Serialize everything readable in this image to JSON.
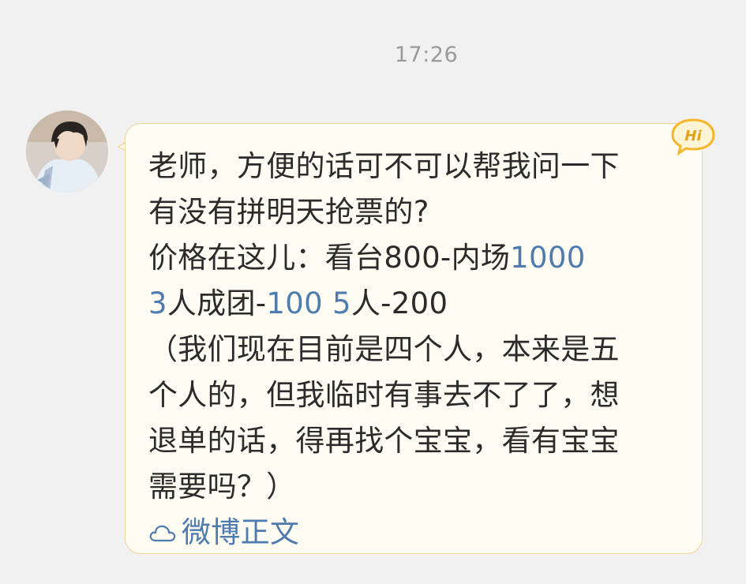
{
  "timestamp": "17:26",
  "message": {
    "line1": "老师，方便的话可不可以帮我问一下",
    "line2": "有没有拼明天抢票的?",
    "line3_text": "价格在这儿：看台800-内场",
    "line3_link": "1000",
    "line4_link1": "3",
    "line4_text1": "人成团-",
    "line4_link2": "100 5",
    "line4_text2": "人-200",
    "line5": "（我们现在目前是四个人，本来是五",
    "line6": "个人的，但我临时有事去不了了，想",
    "line7": "退单的话，得再找个宝宝，看有宝宝",
    "line8": "需要吗？）"
  },
  "weibo_link_label": "微博正文",
  "badge_label": "Hi",
  "colors": {
    "link": "#4f7cae",
    "bubble_bg": "#fffdf3",
    "bubble_border": "#f0d59a",
    "badge": "#f5b62e"
  }
}
